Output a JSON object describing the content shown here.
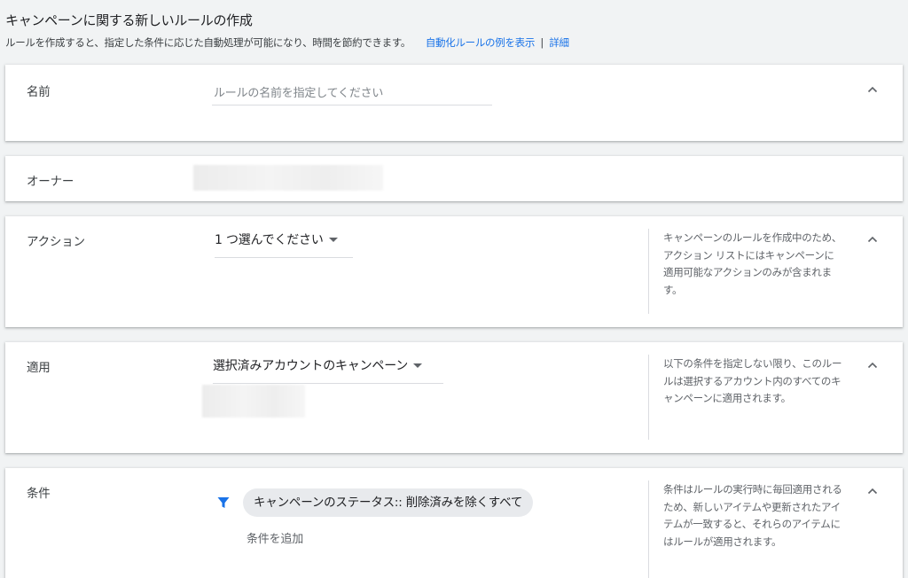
{
  "header": {
    "title": "キャンペーンに関する新しいルールの作成",
    "description": "ルールを作成すると、指定した条件に応じた自動処理が可能になり、時間を節約できます。",
    "examples_link": "自動化ルールの例を表示",
    "separator": "|",
    "details_link": "詳細"
  },
  "name_section": {
    "label": "名前",
    "placeholder": "ルールの名前を指定してください",
    "value": ""
  },
  "owner_section": {
    "label": "オーナー"
  },
  "action_section": {
    "label": "アクション",
    "dropdown_value": "1 つ選んでください",
    "help": "キャンペーンのルールを作成中のため、アクション リストにはキャンペーンに適用可能なアクションのみが含まれます。"
  },
  "apply_section": {
    "label": "適用",
    "dropdown_value": "選択済みアカウントのキャンペーン",
    "help": "以下の条件を指定しない限り、このルールは選択するアカウント内のすべてのキャンペーンに適用されます。"
  },
  "condition_section": {
    "label": "条件",
    "chip_text": "キャンペーンのステータス:: 削除済みを除くすべて",
    "add_condition": "条件を追加",
    "help": "条件はルールの実行時に毎回適用されるため、新しいアイテムや更新されたアイテムが一致すると、それらのアイテムにはルールが適用されます。"
  },
  "icons": {
    "collapse": "chevron-up-icon",
    "filter": "filter-icon",
    "dropdown": "dropdown-arrow-icon"
  },
  "colors": {
    "link": "#1a73e8",
    "filter_icon": "#1a73e8",
    "chip_bg": "#e8eaed",
    "page_bg": "#f1f3f4"
  }
}
